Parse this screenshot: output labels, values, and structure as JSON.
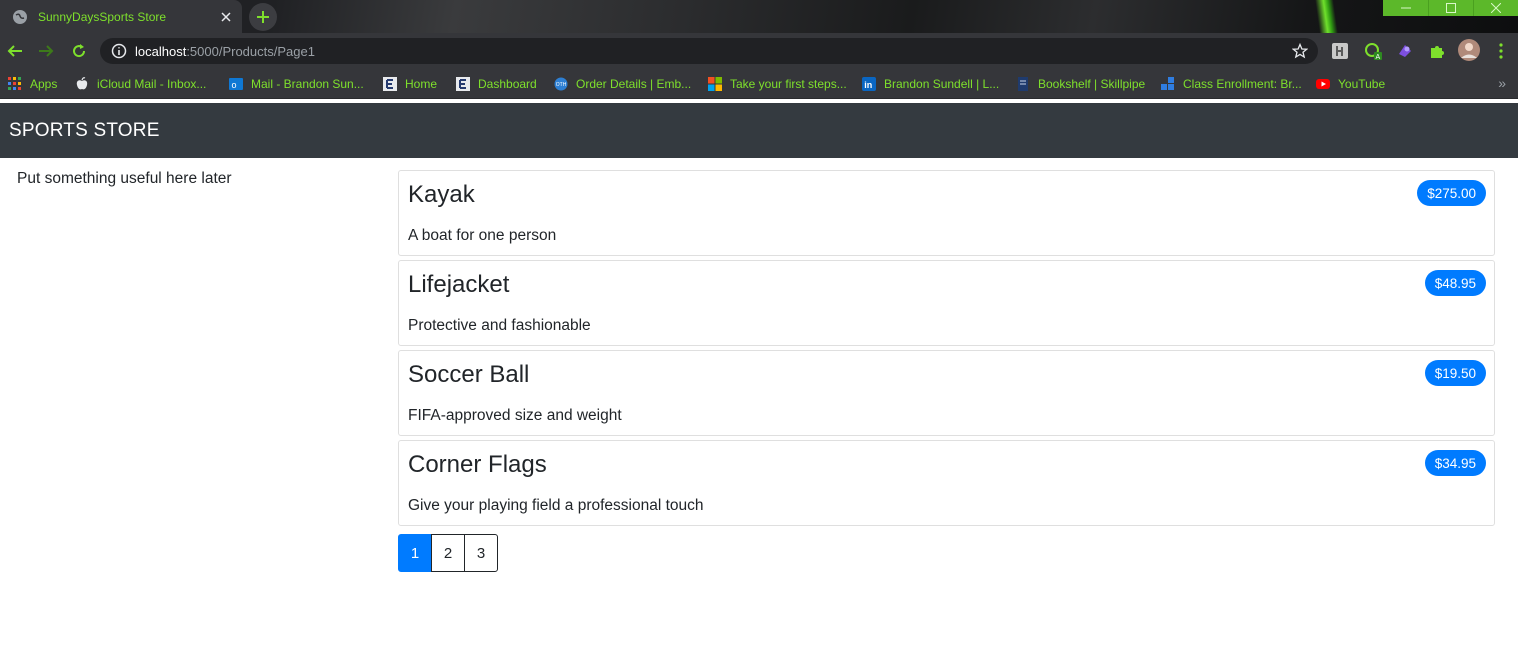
{
  "browser": {
    "tab_title": "SunnyDaysSports Store",
    "url_host": "localhost",
    "url_path": ":5000/Products/Page1",
    "accent_color": "#7ee02c",
    "bookmarks": [
      {
        "label": "Apps",
        "icon": "apps-grid-icon"
      },
      {
        "label": "iCloud Mail - Inbox...",
        "icon": "apple-icon"
      },
      {
        "label": "Mail - Brandon Sun...",
        "icon": "outlook-icon"
      },
      {
        "label": "Home",
        "icon": "e-logo-icon"
      },
      {
        "label": "Dashboard",
        "icon": "e-logo-icon"
      },
      {
        "label": "Order Details | Emb...",
        "icon": "globe-badge-icon"
      },
      {
        "label": "Take your first steps...",
        "icon": "microsoft-icon"
      },
      {
        "label": "Brandon Sundell | L...",
        "icon": "linkedin-icon"
      },
      {
        "label": "Bookshelf | Skillpipe",
        "icon": "book-icon"
      },
      {
        "label": "Class Enrollment: Br...",
        "icon": "blocks-icon"
      },
      {
        "label": "YouTube",
        "icon": "youtube-icon"
      }
    ],
    "bookmarks_more": "»"
  },
  "page": {
    "brand": "SPORTS STORE",
    "sidebar_text": "Put something useful here later",
    "products": [
      {
        "name": "Kayak",
        "description": "A boat for one person",
        "price": "$275.00"
      },
      {
        "name": "Lifejacket",
        "description": "Protective and fashionable",
        "price": "$48.95"
      },
      {
        "name": "Soccer Ball",
        "description": "FIFA-approved size and weight",
        "price": "$19.50"
      },
      {
        "name": "Corner Flags",
        "description": "Give your playing field a professional touch",
        "price": "$34.95"
      }
    ],
    "pagination": [
      "1",
      "2",
      "3"
    ],
    "current_page": "1",
    "navbar_color": "#343a40",
    "primary_color": "#007bff"
  }
}
